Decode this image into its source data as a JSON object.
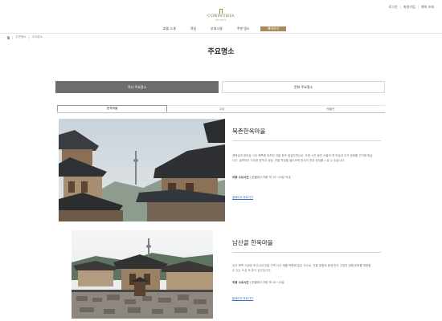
{
  "util_links": [
    "로그인",
    "회원가입",
    "예약 조회"
  ],
  "logo": {
    "name": "CORINTHIA",
    "sub": "HOTELS"
  },
  "gnb": [
    {
      "label": "호텔 소개",
      "active": false
    },
    {
      "label": "객실",
      "active": false
    },
    {
      "label": "부대시설",
      "active": false
    },
    {
      "label": "주변 명소",
      "active": false
    },
    {
      "label": "예약하기",
      "active": true
    }
  ],
  "breadcrumb": [
    "주변명소",
    "주요명소"
  ],
  "page_title": "주요명소",
  "category_tabs": [
    {
      "label": "역사 주요명소",
      "active": true
    },
    {
      "label": "문화 주요명소",
      "active": false
    }
  ],
  "sub_tabs": [
    {
      "label": "한옥마을",
      "active": true
    },
    {
      "label": "고궁",
      "active": false
    },
    {
      "label": "박물관",
      "active": false
    }
  ],
  "cards": [
    {
      "title": "북촌한옥마을",
      "desc": "경복궁과 창덕궁 사이 북쪽에 위치한 전통 한옥 밀집지역으로, 오랜 시간 동안 서울의 옛 모습과 주거 문화를 간직해 왔습니다. 골목마다 자리한 한옥과 공방, 전통 찻집을 둘러보며 한국의 멋과 정취를 느낄 수 있습니다.",
      "addr_label": "이용 소요시간",
      "addr_value": "호텔에서 차량 약 15~20분 이내",
      "more": "홈페이지 바로가기"
    },
    {
      "title": "남산골 한옥마을",
      "desc": "남산 북쪽 기슭에 조선시대 전통 가옥 다섯 채를 복원해 놓은 곳으로, 전통 정원과 함께 한국 고유의 생활 문화를 체험할 수 있는 도심 속 휴식 공간입니다.",
      "addr_label": "이용 소요시간",
      "addr_value": "호텔에서 차량 약 10~15분",
      "more": "홈페이지 바로가기"
    }
  ]
}
